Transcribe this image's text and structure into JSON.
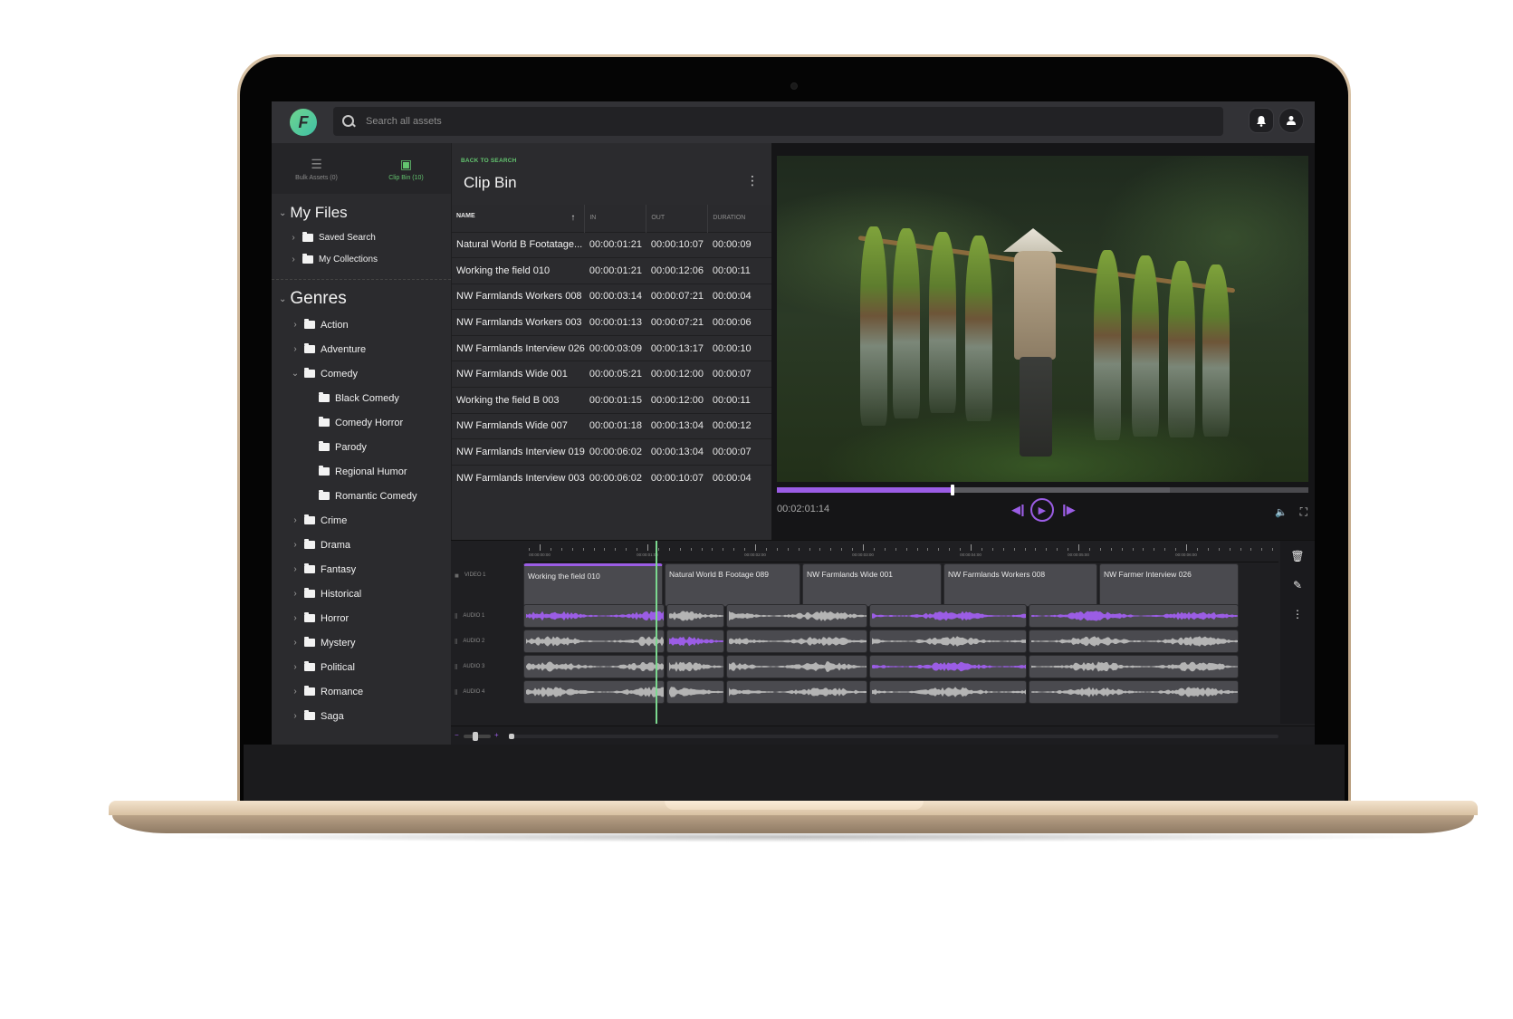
{
  "app": {
    "logo_letter": "F",
    "search_placeholder": "Search all assets",
    "notifications_icon": "bell-icon",
    "account_icon": "user-icon"
  },
  "sidebar": {
    "tabs": [
      {
        "label": "Bulk Assets (0)",
        "icon": "layers-icon",
        "active": false
      },
      {
        "label": "Clip Bin (10)",
        "icon": "film-icon",
        "active": true
      }
    ],
    "my_files": {
      "title": "My Files",
      "items": [
        {
          "label": "Saved Search"
        },
        {
          "label": "My Collections"
        }
      ]
    },
    "genres": {
      "title": "Genres",
      "items": [
        {
          "label": "Action",
          "expanded": false
        },
        {
          "label": "Adventure",
          "expanded": false
        },
        {
          "label": "Comedy",
          "expanded": true,
          "children": [
            "Black Comedy",
            "Comedy Horror",
            "Parody",
            "Regional Humor",
            "Romantic Comedy"
          ]
        },
        {
          "label": "Crime",
          "expanded": false
        },
        {
          "label": "Drama",
          "expanded": false
        },
        {
          "label": "Fantasy",
          "expanded": false
        },
        {
          "label": "Historical",
          "expanded": false
        },
        {
          "label": "Horror",
          "expanded": false
        },
        {
          "label": "Mystery",
          "expanded": false
        },
        {
          "label": "Political",
          "expanded": false
        },
        {
          "label": "Romance",
          "expanded": false
        },
        {
          "label": "Saga",
          "expanded": false
        }
      ]
    }
  },
  "clipbin": {
    "back_label": "BACK TO SEARCH",
    "title": "Clip Bin",
    "columns": [
      "NAME",
      "IN",
      "OUT",
      "DURATION"
    ],
    "sort_indicator": "↑",
    "rows": [
      {
        "name": "Natural World B Footatage...",
        "in": "00:00:01:21",
        "out": "00:00:10:07",
        "duration": "00:00:09"
      },
      {
        "name": "Working the field 010",
        "in": "00:00:01:21",
        "out": "00:00:12:06",
        "duration": "00:00:11"
      },
      {
        "name": "NW Farmlands Workers 008",
        "in": "00:00:03:14",
        "out": "00:00:07:21",
        "duration": "00:00:04"
      },
      {
        "name": "NW Farmlands Workers 003",
        "in": "00:00:01:13",
        "out": "00:00:07:21",
        "duration": "00:00:06"
      },
      {
        "name": "NW Farmlands Interview 026",
        "in": "00:00:03:09",
        "out": "00:00:13:17",
        "duration": "00:00:10"
      },
      {
        "name": "NW Farmlands Wide 001",
        "in": "00:00:05:21",
        "out": "00:00:12:00",
        "duration": "00:00:07"
      },
      {
        "name": "Working the field B 003",
        "in": "00:00:01:15",
        "out": "00:00:12:00",
        "duration": "00:00:11"
      },
      {
        "name": "NW Farmlands Wide 007",
        "in": "00:00:01:18",
        "out": "00:00:13:04",
        "duration": "00:00:12"
      },
      {
        "name": "NW Farmlands Interview 019",
        "in": "00:00:06:02",
        "out": "00:00:13:04",
        "duration": "00:00:07"
      },
      {
        "name": "NW Farmlands Interview 003",
        "in": "00:00:06:02",
        "out": "00:00:10:07",
        "duration": "00:00:04"
      }
    ]
  },
  "player": {
    "timecode": "00:02:01:14",
    "progress": 0.33,
    "buffered": 0.74,
    "accent": "#9b5de5"
  },
  "timeline": {
    "ruler_labels": [
      "00:00:00:00",
      "00:00:01:00",
      "00:00:02:00",
      "00:00:03:00",
      "00:00:04:00",
      "00:00:05:00",
      "00:00:06:00"
    ],
    "playhead_label": "",
    "tracks": [
      {
        "label": "VIDEO 1",
        "type": "video"
      },
      {
        "label": "AUDIO 1",
        "type": "audio"
      },
      {
        "label": "AUDIO 2",
        "type": "audio"
      },
      {
        "label": "AUDIO 3",
        "type": "audio"
      },
      {
        "label": "AUDIO 4",
        "type": "audio"
      }
    ],
    "video_clips": [
      {
        "title": "Working the field 010",
        "selected": true
      },
      {
        "title": "Natural World B Footage 089",
        "selected": false
      },
      {
        "title": "NW Farmlands Wide 001",
        "selected": false
      },
      {
        "title": "NW Farmlands Workers 008",
        "selected": false
      },
      {
        "title": "NW Farmer Interview 026",
        "selected": false
      }
    ],
    "tools": [
      "trash-icon",
      "pencil-icon",
      "more-vertical-icon"
    ],
    "playhead_color": "#7bd88f"
  }
}
